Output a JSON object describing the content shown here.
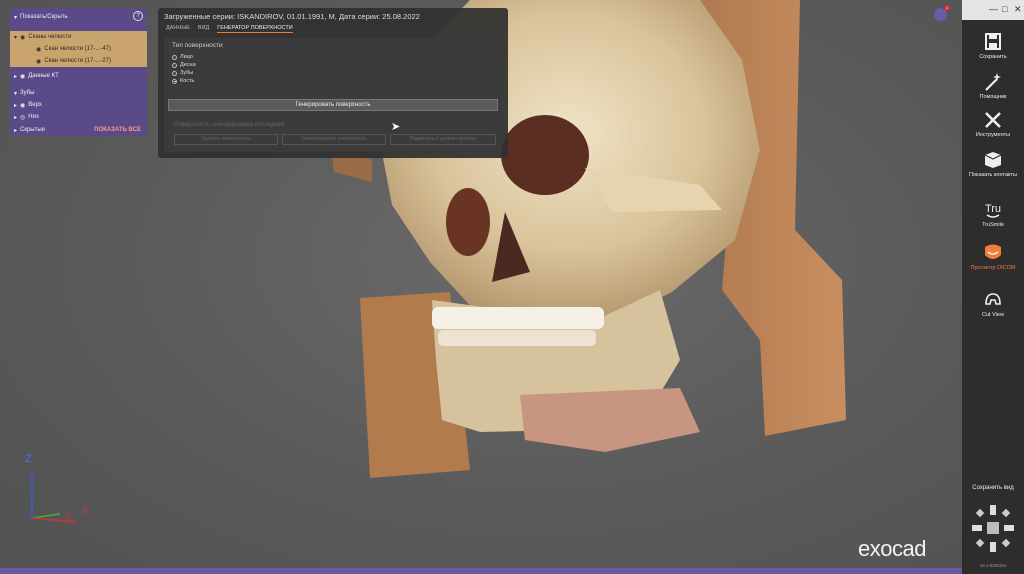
{
  "left_panel": {
    "header": "Показать/Скрыть",
    "help": "?",
    "jaw_group": "Сканы челюсти",
    "jaw_scan_1": "Скан челюсти (17-...-47)",
    "jaw_scan_2": "Скан челюсти (17-...-27)",
    "ct_data": "Данные КТ",
    "teeth": "Зубы",
    "upper": "Верх",
    "lower": "Низ",
    "hidden": "Скрытые",
    "show_all": "ПОКАЗАТЬ ВСЕ"
  },
  "dialog": {
    "title": "Загруженные серии: ISKANDIROV, 01.01.1991, М, Дата серии: 25.08.2022",
    "tabs": [
      {
        "label": "ДАННЫЕ"
      },
      {
        "label": "ВИД"
      },
      {
        "label": "ГЕНЕРАТОР ПОВЕРХНОСТИ"
      }
    ],
    "surface_type_label": "Тип поверхности",
    "options": [
      {
        "label": "Лицо",
        "selected": false
      },
      {
        "label": "Десна",
        "selected": false
      },
      {
        "label": "Зубы",
        "selected": false
      },
      {
        "label": "Кость",
        "selected": true
      }
    ],
    "generate_button": "Генерировать поверхность",
    "last_surface_label": "Поверхность сгенерирована последней",
    "delete_button": "Удалить поверхность",
    "invert_button": "Инвертировать поверхность",
    "snap_button": "Подвесить к уровню протезе"
  },
  "axes": {
    "z": "Z",
    "y": "Y",
    "x": "X"
  },
  "brand": "exocad",
  "notifications": "1",
  "sidebar": {
    "items": [
      {
        "label": "Сохранить",
        "icon": "save-icon"
      },
      {
        "label": "Помощник",
        "icon": "wizard-icon"
      },
      {
        "label": "Инструменты",
        "icon": "tools-icon"
      },
      {
        "label": "Показать контакты",
        "icon": "contacts-icon"
      },
      {
        "label": "TruSmile",
        "icon": "trusmile-icon"
      },
      {
        "label": "Просмотр DICOM",
        "icon": "dicom-icon",
        "active": true
      },
      {
        "label": "Cut View",
        "icon": "cutview-icon"
      }
    ],
    "save_view": "Сохранить вид",
    "version": "v3.1-8250/64"
  },
  "colors": {
    "accent": "#ef7d3c",
    "panel": "#5b4a8a",
    "sidebar": "#2d2d2d"
  }
}
